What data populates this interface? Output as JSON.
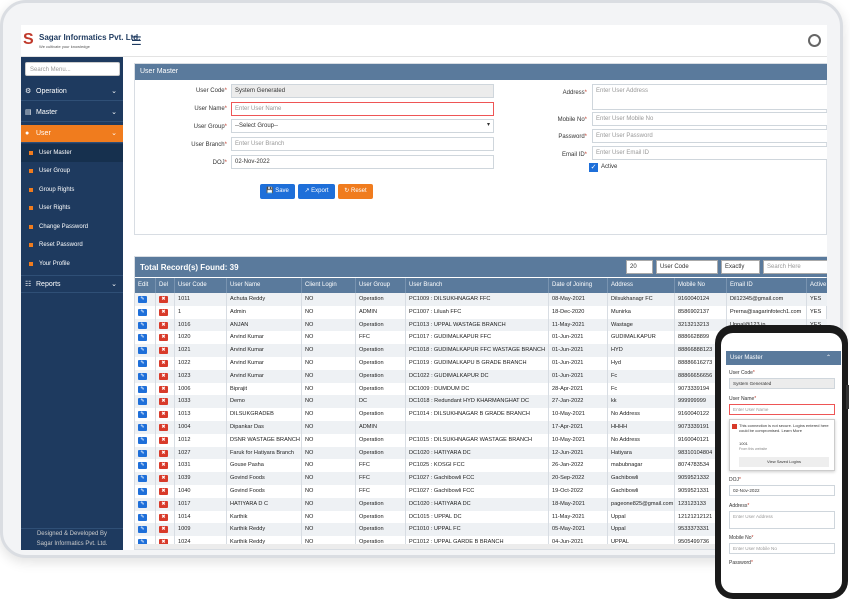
{
  "app": {
    "brand": "Sagar Informatics Pvt. Ltd.",
    "tagline": "We cultivate your knowledge",
    "logo_letter": "S"
  },
  "sidebar": {
    "search_placeholder": "Search Menu...",
    "items": [
      {
        "label": "Operation",
        "icon": "gear-icon"
      },
      {
        "label": "Master",
        "icon": "stack-icon"
      },
      {
        "label": "User",
        "icon": "user-icon"
      }
    ],
    "user_sub": [
      "User Master",
      "User Group",
      "Group Rights",
      "User Rights",
      "Change Password",
      "Reset Password",
      "Your Profile"
    ],
    "reports": "Reports",
    "footer_line1": "Designed & Developed By",
    "footer_line2": "Sagar Informatics Pvt. Ltd."
  },
  "form": {
    "title": "User Master",
    "user_code_label": "User Code",
    "user_code_value": "System Generated",
    "user_name_label": "User Name",
    "user_name_placeholder": "Enter User Name",
    "user_group_label": "User Group",
    "user_group_value": "--Select Group--",
    "user_branch_label": "User Branch",
    "user_branch_placeholder": "Enter User Branch",
    "doj_label": "DOJ",
    "doj_value": "02-Nov-2022",
    "address_label": "Address",
    "address_placeholder": "Enter User Address",
    "mobile_label": "Mobile No",
    "mobile_placeholder": "Enter User Mobile No",
    "password_label": "Password",
    "password_placeholder": "Enter User Password",
    "email_label": "Email ID",
    "email_placeholder": "Enter User Email ID",
    "active_label": "Active",
    "save": "Save",
    "export": "Export",
    "reset": "Reset"
  },
  "table": {
    "total": "Total Record(s) Found: 39",
    "page_size": "20",
    "filter_field": "User Code",
    "filter_mode": "Exactly",
    "search_placeholder": "Search Here",
    "headers": [
      "Edit",
      "Del",
      "User Code",
      "User Name",
      "Client Login",
      "User Group",
      "User Branch",
      "Date of Joining",
      "Address",
      "Mobile No",
      "Email ID",
      "Active"
    ],
    "rows": [
      [
        "1011",
        "Achuta Reddy",
        "NO",
        "Operation",
        "PC1009 : DILSUKHNAGAR FFC",
        "08-May-2021",
        "Dilsukhanagr FC",
        "9160040124",
        "Dil12345@gmail.com",
        "YES"
      ],
      [
        "1",
        "Admin",
        "NO",
        "ADMIN",
        "PC1007 : Liluah FFC",
        "18-Dec-2020",
        "Munirka",
        "8586902137",
        "Prerna@sagarinfotech1.com",
        "YES"
      ],
      [
        "1016",
        "ANJAN",
        "NO",
        "Operation",
        "PC1013 : UPPAL WASTAGE BRANCH",
        "11-May-2021",
        "Wastage",
        "3213213213",
        "Uppal@123.in",
        "YES"
      ],
      [
        "1020",
        "Arvind Kumar",
        "NO",
        "FFC",
        "PC1017 : GUDIMALKAPUR FFC",
        "01-Jun-2021",
        "GUDIMALKAPUR",
        "8886628899",
        "yateesree@gmail.com",
        "YES"
      ],
      [
        "1021",
        "Arvind Kumar",
        "NO",
        "Operation",
        "PC1018 : GUDIMALKAPUR FFC WASTAGE BRANCH",
        "01-Jun-2021",
        "HYD",
        "88866888123",
        "yateesree123@gmail.com",
        "YES"
      ],
      [
        "1022",
        "Arvind Kumar",
        "NO",
        "Operation",
        "PC1019 : GUDIMALKAPU B GRADE BRANCH",
        "01-Jun-2021",
        "Hyd",
        "88886616273",
        "yateesree@gmail.com",
        "YES"
      ],
      [
        "1023",
        "Arvind Kumar",
        "NO",
        "Operation",
        "DC1022 : GUDIMALKAPUR DC",
        "01-Jun-2021",
        "Fc",
        "88866656656",
        "yateesree@gmail.com",
        "YES"
      ],
      [
        "1006",
        "Biprajit",
        "NO",
        "Operation",
        "DC1009 : DUMDUM DC",
        "28-Apr-2021",
        "Fc",
        "9073339194",
        "biprajit@gmail.com",
        "YES"
      ],
      [
        "1033",
        "Demo",
        "NO",
        "DC",
        "DC1018 : Redundant HYD KHARMANGHAT DC",
        "27-Jan-2022",
        "kk",
        "999999999",
        "demo@gmail.com",
        "YES"
      ],
      [
        "1013",
        "DILSUKGRADEB",
        "NO",
        "Operation",
        "PC1014 : DILSUKHNAGAR B GRADE BRANCH",
        "10-May-2021",
        "No Address",
        "9160040122",
        "bgrade@gmail.com",
        "YES"
      ],
      [
        "1004",
        "Dipankar Das",
        "NO",
        "ADMIN",
        "",
        "17-Apr-2021",
        "HHHH",
        "9073339191",
        "dipankar@gmail.com",
        "YES"
      ],
      [
        "1012",
        "DSNR WASTAGE BRANCH",
        "NO",
        "Operation",
        "PC1015 : DILSUKHNAGAR WASTAGE BRANCH",
        "10-May-2021",
        "No Address",
        "9160040121",
        "wastage@gmail.com",
        "YES"
      ],
      [
        "1027",
        "Faruk for Hatiyara Branch",
        "NO",
        "Operation",
        "DC1020 : HATIYARA DC",
        "12-Jun-2021",
        "Hatiyara",
        "98310104804",
        "faruk@gmail.com",
        "YES"
      ],
      [
        "1031",
        "Gouse Pasha",
        "NO",
        "FFC",
        "PC1025 : KOSGI FCC",
        "26-Jan-2022",
        "mabubnagar",
        "8074783534",
        "gouse@gmail.com",
        "YES"
      ],
      [
        "1039",
        "Govind Foods",
        "NO",
        "FFC",
        "PC1027 : Gachibowli FCC",
        "20-Sep-2022",
        "Gachibowli",
        "9059521332",
        "govind@gmail.com",
        "YES"
      ],
      [
        "1040",
        "Govind Foods",
        "NO",
        "FFC",
        "PC1027 : Gachibowli FCC",
        "19-Oct-2022",
        "Gachibowli",
        "9059521331",
        "govind1@gmail.com",
        "YES"
      ],
      [
        "1017",
        "HATIYARA D C",
        "NO",
        "Operation",
        "DC1020 : HATIYARA DC",
        "18-May-2021",
        "pageone825@gmail.com",
        "123123133",
        "hatiyara@gmail.com",
        "YES"
      ],
      [
        "1014",
        "Karthik",
        "NO",
        "Operation",
        "DC1015 : UPPAL DC",
        "11-May-2021",
        "Uppal",
        "12121212121",
        "karthik@gmail.com",
        "YES"
      ],
      [
        "1009",
        "Karthik Reddy",
        "NO",
        "Operation",
        "PC1010 : UPPAL FC",
        "05-May-2021",
        "Uppal",
        "9533373331",
        "karthik1@gmail.com",
        "YES"
      ],
      [
        "1024",
        "Karthik Reddy",
        "NO",
        "Operation",
        "PC1012 : UPPAL GARDE B BRANCH",
        "04-Jun-2021",
        "UPPAL",
        "9505499736",
        "karthik2@gmail.com",
        "YES"
      ]
    ]
  },
  "mobile": {
    "title": "User Master",
    "user_code_label": "User Code",
    "user_code_value": "System Generated",
    "user_name_label": "User Name",
    "user_name_placeholder": "Enter User Name",
    "warning_text": "This connection is not secure. Logins entered here could be compromised. Learn More",
    "saved_user": "1001",
    "saved_source": "From this website",
    "view_saved": "View Saved Logins",
    "doj_label": "DOJ",
    "doj_value": "02-Nov-2022",
    "address_label": "Address",
    "address_placeholder": "Enter User Address",
    "mobile_label": "Mobile No",
    "mobile_placeholder": "Enter User Mobile No",
    "password_label": "Password"
  },
  "colors": {
    "sidebar": "#1e3a5f",
    "accent": "#f07c1e",
    "header": "#5a7a9c",
    "primary": "#1e6fd9",
    "danger": "#d83a2a"
  }
}
